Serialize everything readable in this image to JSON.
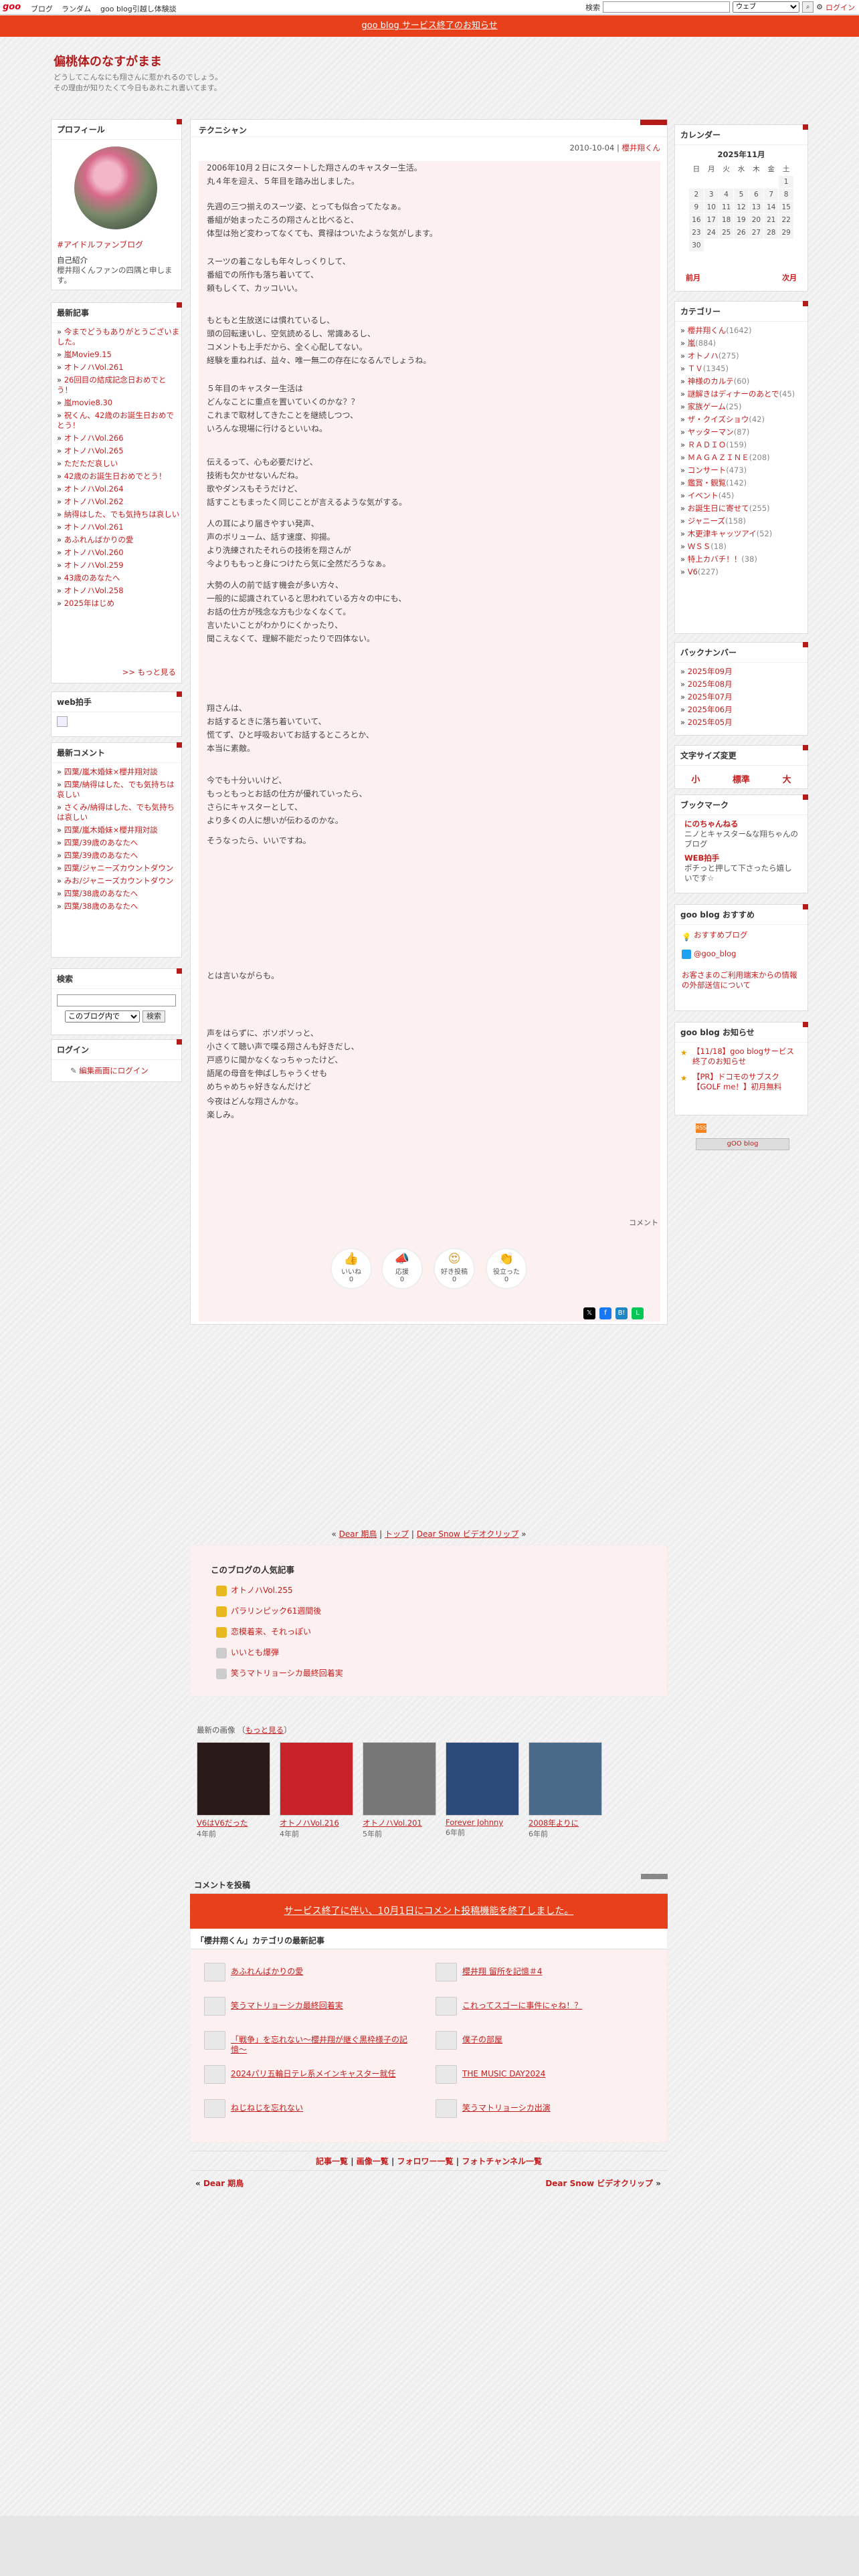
{
  "topbar": {
    "logo": "goo",
    "links": [
      "ブログ",
      "ランダム",
      "goo blog引越し体験談"
    ],
    "search_label": "検索",
    "search_scope": "ウェブ",
    "login": "ログイン"
  },
  "notice": "goo blog サービス終了のお知らせ",
  "blog": {
    "title": "偏桃体のなすがまま",
    "desc": "どうしてこんなにも翔さんに惹かれるのでしょう。\nその理由が知りたくて今日もあれこれ書いてます。"
  },
  "profile": {
    "title": "プロフィール",
    "tag": "#アイドルファンブログ",
    "intro_title": "自己紹介",
    "intro": "櫻井翔くんファンの四隅と申します。"
  },
  "recent": {
    "title": "最新記事",
    "items": [
      "今までどうもありがとうございました。",
      "嵐Movie9.15",
      "オトノハVol.261",
      "26回目の結成記念日おめでとう！",
      "嵐movie8.30",
      "祝くん、42歳のお誕生日おめでとう！",
      "オトノハVol.266",
      "オトノハVol.265",
      "ただただ哀しい",
      "42歳のお誕生日おめでとう！",
      "オトノハVol.264",
      "オトノハVol.262",
      "納得はした、でも気持ちは哀しい",
      "オトノハVol.261",
      "あふれんばかりの愛",
      "オトノハVol.260",
      "オトノハVol.259",
      "43歳のあなたへ",
      "オトノハVol.258",
      "2025年はじめ"
    ],
    "more": ">> もっと見る"
  },
  "webclap": {
    "title": "web拍手"
  },
  "comments": {
    "title": "最新コメント",
    "items": [
      "四葉/嵐木婚妹×櫻井翔対談",
      "四葉/納得はした、でも気持ちは哀しい",
      "さくみ/納得はした、でも気持ちは哀しい",
      "四葉/嵐木婚妹×櫻井翔対談",
      "四葉/39歳のあなたへ",
      "四葉/39歳のあなたへ",
      "四葉/ジャニーズカウントダウン",
      "みお/ジャニーズカウントダウン",
      "四葉/38歳のあなたへ",
      "四葉/38歳のあなたへ"
    ]
  },
  "search": {
    "title": "検索",
    "scope": "このブログ内で",
    "button": "検索"
  },
  "login": {
    "title": "ログイン",
    "link": "編集画面にログイン"
  },
  "article": {
    "heading": "テクニシャン",
    "date": "2010-10-04",
    "author": "櫻井翔くん",
    "blocks": [
      "2006年10月２日にスタートした翔さんのキャスター生活。\n丸４年を迎え、５年目を踏み出しました。",
      "先週の三つ揃えのスーツ姿、とっても似合ってたなぁ。\n番組が始まったころの翔さんと比べると、\n体型は殆ど変わってなくても、貫禄はついたような気がします。",
      "スーツの着こなしも年々しっくりして、\n番組での所作も落ち着いてて、\n頼もしくて、カッコいい。",
      "もともと生放送には慣れているし、\n頭の回転速いし、空気読めるし、常識あるし、\nコメントも上手だから、全く心配してない。\n経験を重ねれば、益々、唯一無二の存在になるんでしょうね。",
      "５年目のキャスター生活は\nどんなことに重点を置いていくのかな？？\nこれまで取材してきたことを継続しつつ、\nいろんな現場に行けるといいね。",
      "伝えるって、心も必要だけど、\n技術も欠かせないんだね。\n歌やダンスもそうだけど、\n話すこともまったく同じことが言えるような気がする。",
      "人の耳により届きやすい発声、\n声のボリューム、話す速度、抑揚。\nより洗練されたそれらの技術を翔さんが\n今よりももっと身につけたら気に全然だろうなぁ。",
      "大勢の人の前で話す機会が多い方々、\n一般的に認識されていると思われている方々の中にも、\nお話の仕方が残念な方も少なくなくて。\n言いたいことがわかりにくかったり、\n聞こえなくて、理解不能だったりで四体ない。",
      "翔さんは、\nお話するときに落ち着いていて、\n慌てず、ひと呼吸おいてお話するところとか、\n本当に素敵。",
      "今でも十分いいけど、\nもっともっとお話の仕方が優れていったら、\nさらにキャスターとして、\nより多くの人に想いが伝わるのかな。",
      "そうなったら、いいですね。",
      "とは言いながらも。",
      "声をはらずに、ボソボソっと、\n小さくて聴い声で喋る翔さんも好きだし、\n戸惑りに聞かなくなっちゃったけど、\n語尾の母音を伸ばしちゃうくせも\nめちゃめちゃ好きなんだけど",
      "今夜はどんな翔さんかな。\n楽しみ。"
    ],
    "comment_link": "コメント",
    "reactions": [
      {
        "label": "いいね",
        "count": "0"
      },
      {
        "label": "応援",
        "count": "0"
      },
      {
        "label": "好き投稿",
        "count": "0"
      },
      {
        "label": "役立った",
        "count": "0"
      }
    ]
  },
  "pager": {
    "prev": "Dear 期鳥",
    "top": "トップ",
    "next": "Dear Snow ビデオクリップ"
  },
  "popular": {
    "title": "このブログの人気記事",
    "items": [
      "オトノハVol.255",
      "パラリンピック61週間後",
      "恋模着来、それっぽい",
      "いいとも爆弾",
      "笑うマトリョーシカ最終回着実"
    ]
  },
  "images": {
    "title": "最新の画像",
    "more": "もっと見る",
    "items": [
      {
        "title": "V6はV6だった",
        "age": "4年前",
        "color": "#2a1a1a"
      },
      {
        "title": "オトノハVol.216",
        "age": "4年前",
        "color": "#c8222a"
      },
      {
        "title": "オトノハVol.201",
        "age": "5年前",
        "color": "#777"
      },
      {
        "title": "Forever Johnny",
        "age": "6年前",
        "color": "#2c4a7a"
      },
      {
        "title": "2008年よりに",
        "age": "6年前",
        "color": "#4a6a8a"
      }
    ]
  },
  "comment_post": {
    "title": "コメントを投稿",
    "notice": "サービス終了に伴い、10月1日にコメント投稿機能を終了しました。"
  },
  "category_latest": {
    "title": "「櫻井翔くん」カテゴリの最新記事",
    "left": [
      "あふれんばかりの愛",
      "笑うマトリョーシカ最終回着実",
      "「戦争」を忘れない〜櫻井翔が継ぐ黒枠様子の記憶〜",
      "2024パリ五輪日テレ系メインキャスター就任",
      "ねじねじを忘れない"
    ],
    "right": [
      "櫻井翔 留所を記憶＃4",
      "これってスゴーに事件にゃね！？",
      "僕子の部屋",
      "THE MUSIC DAY2024",
      "笑うマトリョーシカ出演"
    ]
  },
  "footer_links": [
    "記事一覧",
    "画像一覧",
    "フォロワー一覧",
    "フォトチャンネル一覧"
  ],
  "footer_prev": "Dear 期鳥",
  "footer_next": "Dear Snow ビデオクリップ",
  "calendar": {
    "title": "カレンダー",
    "month": "2025年11月",
    "days": [
      "日",
      "月",
      "火",
      "水",
      "木",
      "金",
      "土"
    ],
    "weeks": [
      [
        "",
        "",
        "",
        "",
        "",
        "",
        "1"
      ],
      [
        "2",
        "3",
        "4",
        "5",
        "6",
        "7",
        "8"
      ],
      [
        "9",
        "10",
        "11",
        "12",
        "13",
        "14",
        "15"
      ],
      [
        "16",
        "17",
        "18",
        "19",
        "20",
        "21",
        "22"
      ],
      [
        "23",
        "24",
        "25",
        "26",
        "27",
        "28",
        "29"
      ],
      [
        "30",
        "",
        "",
        "",
        "",
        "",
        ""
      ]
    ],
    "prev": "前月",
    "next": "次月"
  },
  "categories": {
    "title": "カテゴリー",
    "items": [
      [
        "櫻井翔くん",
        "(1642)"
      ],
      [
        "嵐",
        "(884)"
      ],
      [
        "オトノハ",
        "(275)"
      ],
      [
        "ＴＶ",
        "(1345)"
      ],
      [
        "神様のカルテ",
        "(60)"
      ],
      [
        "謎解きはディナーのあとで",
        "(45)"
      ],
      [
        "家族ゲーム",
        "(25)"
      ],
      [
        "ザ・クイズショウ",
        "(42)"
      ],
      [
        "ヤッターマン",
        "(87)"
      ],
      [
        "ＲＡＤＩＯ",
        "(159)"
      ],
      [
        "ＭＡＧＡＺＩＮＥ",
        "(208)"
      ],
      [
        "コンサート",
        "(473)"
      ],
      [
        "鑑賞・観覧",
        "(142)"
      ],
      [
        "イベント",
        "(45)"
      ],
      [
        "お誕生日に寄せて",
        "(255)"
      ],
      [
        "ジャニーズ",
        "(158)"
      ],
      [
        "木更津キャッツアイ",
        "(52)"
      ],
      [
        "ＷＳＳ",
        "(18)"
      ],
      [
        "特上カバチ！！",
        "(38)"
      ],
      [
        "V6",
        "(227)"
      ]
    ]
  },
  "backnumber": {
    "title": "バックナンバー",
    "items": [
      "2025年09月",
      "2025年08月",
      "2025年07月",
      "2025年06月",
      "2025年05月"
    ]
  },
  "fontsize": {
    "title": "文字サイズ変更",
    "items": [
      "小",
      "標準",
      "大"
    ]
  },
  "bookmark": {
    "title": "ブックマーク",
    "items": [
      {
        "name": "にのちゃんねる",
        "desc": "ニノとキャスター&な翔ちゃんのブログ"
      },
      {
        "name": "WEB拍手",
        "desc": "ポチっと押して下さったら嬉しいです☆"
      }
    ]
  },
  "goo_recommend": {
    "title": "goo blog おすすめ",
    "items": [
      "おすすめブログ",
      "@goo_blog"
    ],
    "note": "お客さまのご利用端末からの情報の外部送信について"
  },
  "goo_news": {
    "title": "goo blog お知らせ",
    "items": [
      "【11/18】goo blogサービス終了のお知らせ",
      "【PR】ドコモのサブスク【GOLF me！】初月無料"
    ]
  },
  "rss": "RSS",
  "goo_badge": "gOO blog"
}
